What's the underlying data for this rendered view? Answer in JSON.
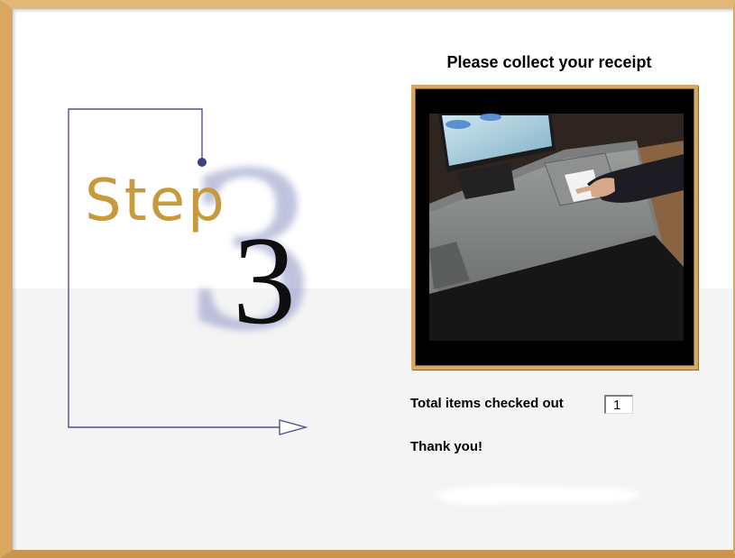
{
  "step": {
    "word": "Step",
    "number": "3"
  },
  "panel": {
    "title": "Please collect your receipt",
    "total_label": "Total items checked out",
    "total_value": "1",
    "thanks": "Thank you!"
  },
  "colors": {
    "frame": "#d9a75f",
    "step_word": "#c79a3d",
    "line": "#4d5193"
  },
  "icons": {
    "arrow": "arrow-right-icon"
  }
}
